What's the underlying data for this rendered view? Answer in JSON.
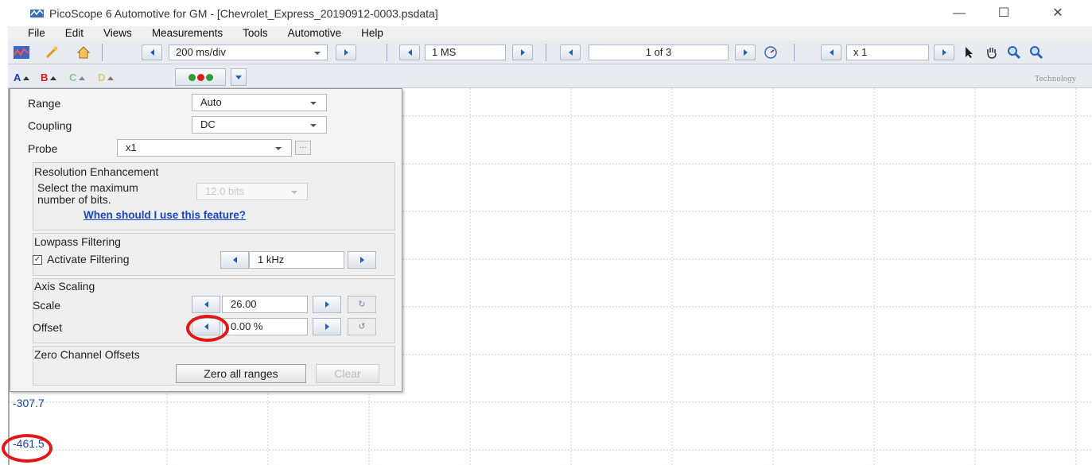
{
  "window": {
    "title": "PicoScope 6 Automotive for GM - [Chevrolet_Express_20190912-0003.psdata]",
    "minimize": "—",
    "maximize": "☐",
    "close": "✕"
  },
  "menu": [
    "File",
    "Edit",
    "Views",
    "Measurements",
    "Tools",
    "Automotive",
    "Help"
  ],
  "toolbar": {
    "timebase": "200 ms/div",
    "samples": "1 MS",
    "buffer": "1 of 3",
    "zoom": "x 1"
  },
  "channels": [
    "A",
    "B",
    "C",
    "D"
  ],
  "logo_text": "Technology",
  "panel": {
    "range_label": "Range",
    "range_value": "Auto",
    "coupling_label": "Coupling",
    "coupling_value": "DC",
    "probe_label": "Probe",
    "probe_value": "x1",
    "probe_dots": "…",
    "resolution_title": "Resolution Enhancement",
    "resolution_text_1": "Select the maximum",
    "resolution_text_2": "number of bits.",
    "resolution_value": "12.0 bits",
    "resolution_link": "When should I use this feature?",
    "lowpass_title": "Lowpass Filtering",
    "lowpass_check": "Activate Filtering",
    "lowpass_value": "1 kHz",
    "axis_title": "Axis Scaling",
    "scale_label": "Scale",
    "scale_value": "26.00",
    "offset_label": "Offset",
    "offset_value": "0.00 %",
    "zero_title": "Zero Channel Offsets",
    "zero_button": "Zero all ranges",
    "zero_disabled_button": "Clear"
  },
  "axis": {
    "y_label_1": "-307.7",
    "y_label_2": "-461.5"
  },
  "colors": {
    "axis_label": "#1a3fb0",
    "highlight": "#e01818",
    "grid": "#b9d9d7"
  }
}
